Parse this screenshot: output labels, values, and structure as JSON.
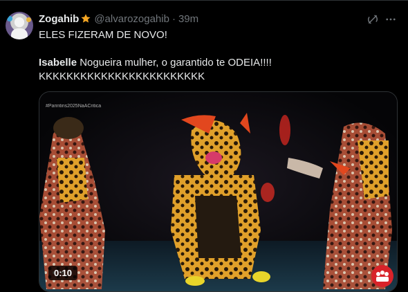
{
  "tweet": {
    "display_name": "Zogahib",
    "handle": "@alvarozogahib",
    "separator": "·",
    "time": "39m",
    "badge_icon": "star-icon",
    "line1": "ELES FIZERAM DE NOVO!",
    "line2_bold": "Isabelle",
    "line2_rest": " Nogueira mulher, o garantido te ODEIA!!!!",
    "line3": "KKKKKKKKKKKKKKKKKKKKKKKK"
  },
  "media": {
    "type": "video",
    "duration": "0:10",
    "hashtag": "#Parintins2025NaACritica"
  },
  "colors": {
    "background": "#000000",
    "text": "#e7e9ea",
    "muted": "#71767b",
    "star": "#f5a623",
    "border": "#2f3336"
  },
  "icons": [
    "grok-icon",
    "more-options-icon"
  ]
}
